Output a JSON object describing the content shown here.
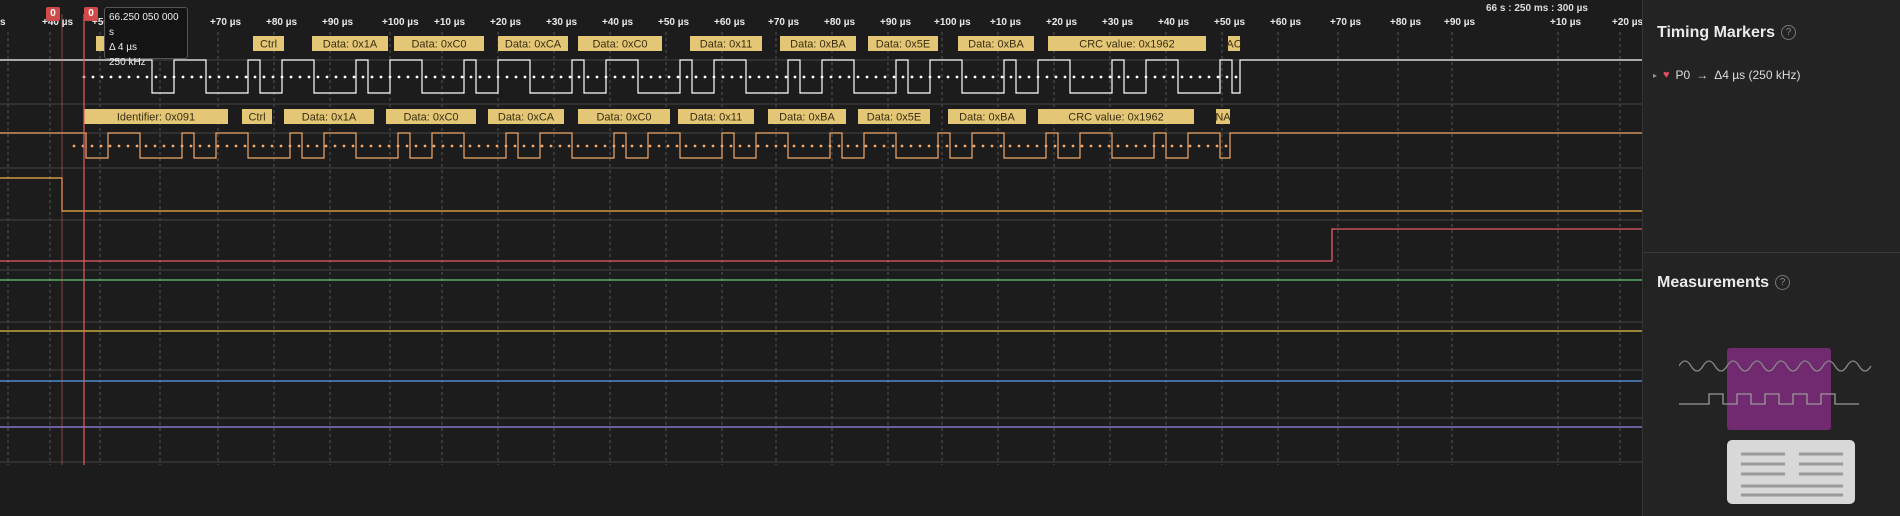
{
  "time_reference": "66 s : 250 ms : 300 µs",
  "ruler": {
    "labels": [
      "s",
      "+40 µs",
      "+50 µs",
      "+60 µs",
      "+70 µs",
      "+80 µs",
      "+90 µs",
      "+100 µs",
      "+10 µs",
      "+20 µs",
      "+30 µs",
      "+40 µs",
      "+50 µs",
      "+60 µs",
      "+70 µs",
      "+80 µs",
      "+90 µs",
      "+100 µs",
      "+10 µs",
      "+20 µs",
      "+30 µs",
      "+40 µs",
      "+50 µs",
      "+60 µs",
      "+70 µs",
      "+80 µs",
      "+90 µs",
      "+10 µs",
      "+20 µs"
    ]
  },
  "markers": [
    {
      "label": "0"
    },
    {
      "label": "0"
    }
  ],
  "tooltip": {
    "time": "66.250 050 000 s",
    "delta": "Δ 4 µs",
    "freq": "250 kHz"
  },
  "decodes": {
    "row1": [
      "091",
      "Ctrl",
      "Data: 0x1A",
      "Data: 0xC0",
      "Data: 0xCA",
      "Data: 0xC0",
      "Data: 0x11",
      "Data: 0xBA",
      "Data: 0x5E",
      "Data: 0xBA",
      "CRC value: 0x1962",
      "AC"
    ],
    "row2": [
      "Identifier: 0x091",
      "Ctrl",
      "Data: 0x1A",
      "Data: 0xC0",
      "Data: 0xCA",
      "Data: 0xC0",
      "Data: 0x11",
      "Data: 0xBA",
      "Data: 0x5E",
      "Data: 0xBA",
      "CRC value: 0x1962",
      "NA"
    ]
  },
  "colors": {
    "decode_bg": "#e3c777",
    "decode_text": "#3a2e10",
    "ch0": "#ffffff",
    "ch1": "#f2a96a",
    "ch2": "#f5b24a",
    "ch3": "#e45c6a",
    "ch4": "#5cc97a",
    "ch5": "#e8c544",
    "ch6": "#5b9be8",
    "ch7": "#9a86e8",
    "marker": "#e06060"
  },
  "side": {
    "timing_markers_title": "Timing Markers",
    "marker_entry": {
      "name": "P0",
      "arrow": "→",
      "value": "Δ4 µs (250 kHz)"
    },
    "measurements_title": "Measurements",
    "help_glyph": "?"
  }
}
